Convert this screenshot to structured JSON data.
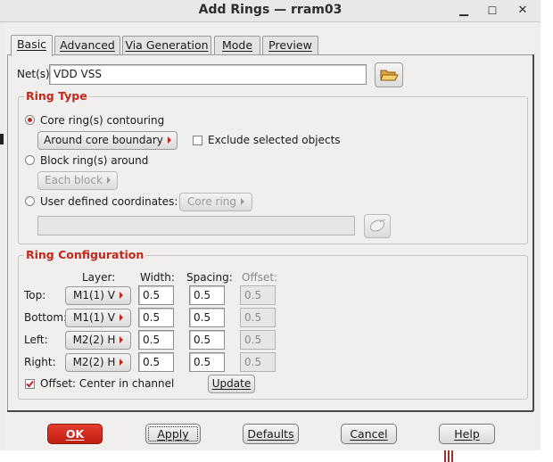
{
  "window": {
    "title": "Add Rings — rram03",
    "minimize_glyph": "▁",
    "maximize_glyph": "☐",
    "close_glyph": "✕"
  },
  "tabs": [
    "Basic",
    "Advanced",
    "Via Generation",
    "Mode",
    "Preview"
  ],
  "nets": {
    "label": "Net(s):",
    "value": "VDD VSS",
    "browse_icon": "folder-open-icon"
  },
  "ring_type": {
    "title": "Ring Type",
    "core_ring_label": "Core ring(s) contouring",
    "core_ring_selected": true,
    "around_core_button": "Around core boundary",
    "exclude_label": "Exclude selected objects",
    "exclude_checked": false,
    "block_ring_label": "Block ring(s) around",
    "each_block_button": "Each block",
    "user_defined_label": "User defined coordinates:",
    "core_ring_button": "Core ring",
    "coordinates_value": "",
    "mouse_icon": "mouse-icon"
  },
  "ring_config": {
    "title": "Ring Configuration",
    "headers": {
      "layer": "Layer:",
      "width": "Width:",
      "spacing": "Spacing:",
      "offset": "Offset:"
    },
    "rows": [
      {
        "side": "Top:",
        "layer": "M1(1) V",
        "width": "0.5",
        "spacing": "0.5",
        "offset": "0.5"
      },
      {
        "side": "Bottom:",
        "layer": "M1(1) V",
        "width": "0.5",
        "spacing": "0.5",
        "offset": "0.5"
      },
      {
        "side": "Left:",
        "layer": "M2(2) H",
        "width": "0.5",
        "spacing": "0.5",
        "offset": "0.5"
      },
      {
        "side": "Right:",
        "layer": "M2(2) H",
        "width": "0.5",
        "spacing": "0.5",
        "offset": "0.5"
      }
    ],
    "offset_center_label": "Offset: Center in channel",
    "offset_center_checked": true,
    "update_button": "Update"
  },
  "buttons": {
    "ok": "OK",
    "apply": "Apply",
    "defaults": "Defaults",
    "cancel": "Cancel",
    "help": "Help"
  },
  "colors": {
    "accent": "#c0281c",
    "ok_button": "#d42f20"
  }
}
